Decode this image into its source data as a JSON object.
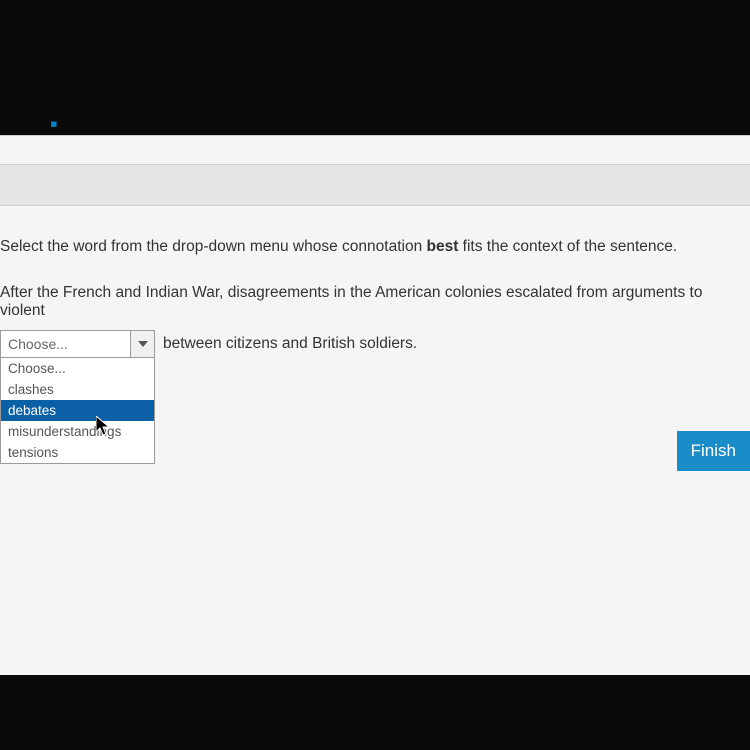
{
  "instruction_prefix": "Select the word from the drop-down menu whose connotation ",
  "instruction_bold": "best",
  "instruction_suffix": " fits the context of the sentence.",
  "sentence_part1": "After the French and Indian War, disagreements in the American colonies escalated from arguments to violent",
  "sentence_part2": "between citizens and British soldiers.",
  "dropdown": {
    "selected": "Choose...",
    "options": [
      "Choose...",
      "clashes",
      "debates",
      "misunderstandings",
      "tensions"
    ],
    "highlighted_index": 2
  },
  "finish_label": "Finish"
}
